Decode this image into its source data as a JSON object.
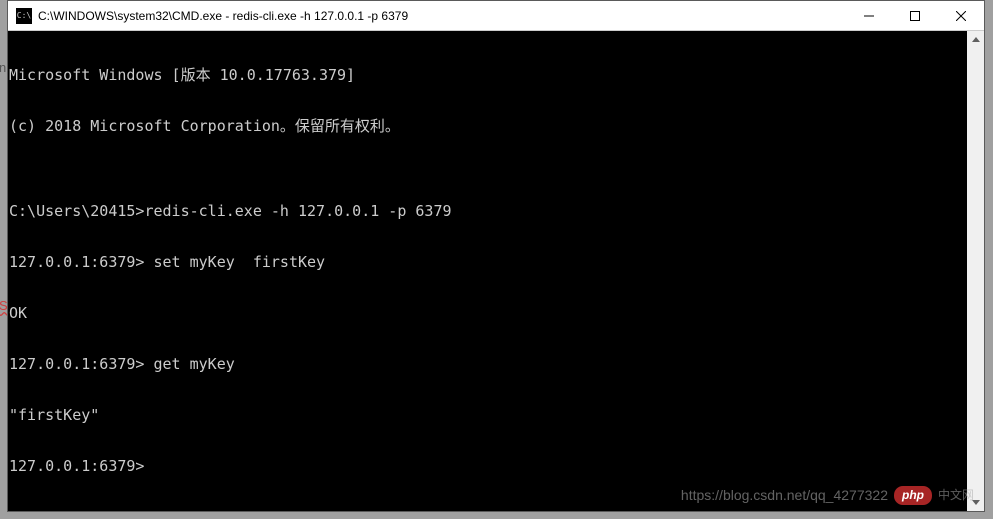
{
  "window": {
    "icon_label": "C:\\",
    "title": "C:\\WINDOWS\\system32\\CMD.exe - redis-cli.exe  -h 127.0.0.1 -p 6379"
  },
  "terminal": {
    "lines": [
      "Microsoft Windows [版本 10.0.17763.379]",
      "(c) 2018 Microsoft Corporation。保留所有权利。",
      "",
      "C:\\Users\\20415>redis-cli.exe -h 127.0.0.1 -p 6379",
      "127.0.0.1:6379> set myKey  firstKey",
      "OK",
      "127.0.0.1:6379> get myKey",
      "\"firstKey\"",
      "127.0.0.1:6379>"
    ]
  },
  "watermark": {
    "url": "https://blog.csdn.net/qq_4277322",
    "badge": "php",
    "cn": "中文网"
  },
  "side": {
    "s": "S",
    "n": "n"
  }
}
